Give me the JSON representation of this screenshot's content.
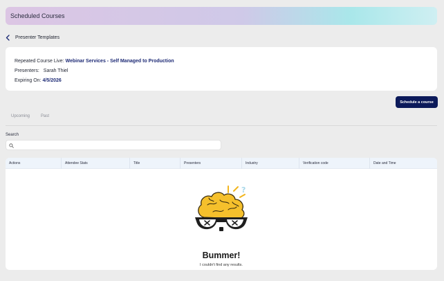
{
  "header": {
    "title": "Scheduled Courses"
  },
  "back": {
    "label": "Presenter Templates"
  },
  "course_info": {
    "course_label": "Repeated Course Live:",
    "course_value": "Webinar Services - Self Managed to Production",
    "presenters_label": "Presenters:",
    "presenters_value": "Sarah Thiel",
    "expiring_label": "Expiring On:",
    "expiring_value": "4/5/2026"
  },
  "actions": {
    "schedule_label": "Schedule a course"
  },
  "tabs": [
    {
      "label": "Upcoming"
    },
    {
      "label": "Past"
    }
  ],
  "search": {
    "label": "Search",
    "placeholder": "",
    "value": ""
  },
  "table": {
    "columns": [
      "Actions",
      "Attendee Stats",
      "Title",
      "Presenters",
      "Industry",
      "Verification code",
      "Date and Time"
    ]
  },
  "empty_state": {
    "title": "Bummer!",
    "message": "I couldn't find any results.",
    "illustration": "brain-with-glasses-icon"
  },
  "colors": {
    "accent": "#0c1a5a",
    "link": "#1d2a75",
    "brain": "#f5c02c"
  }
}
